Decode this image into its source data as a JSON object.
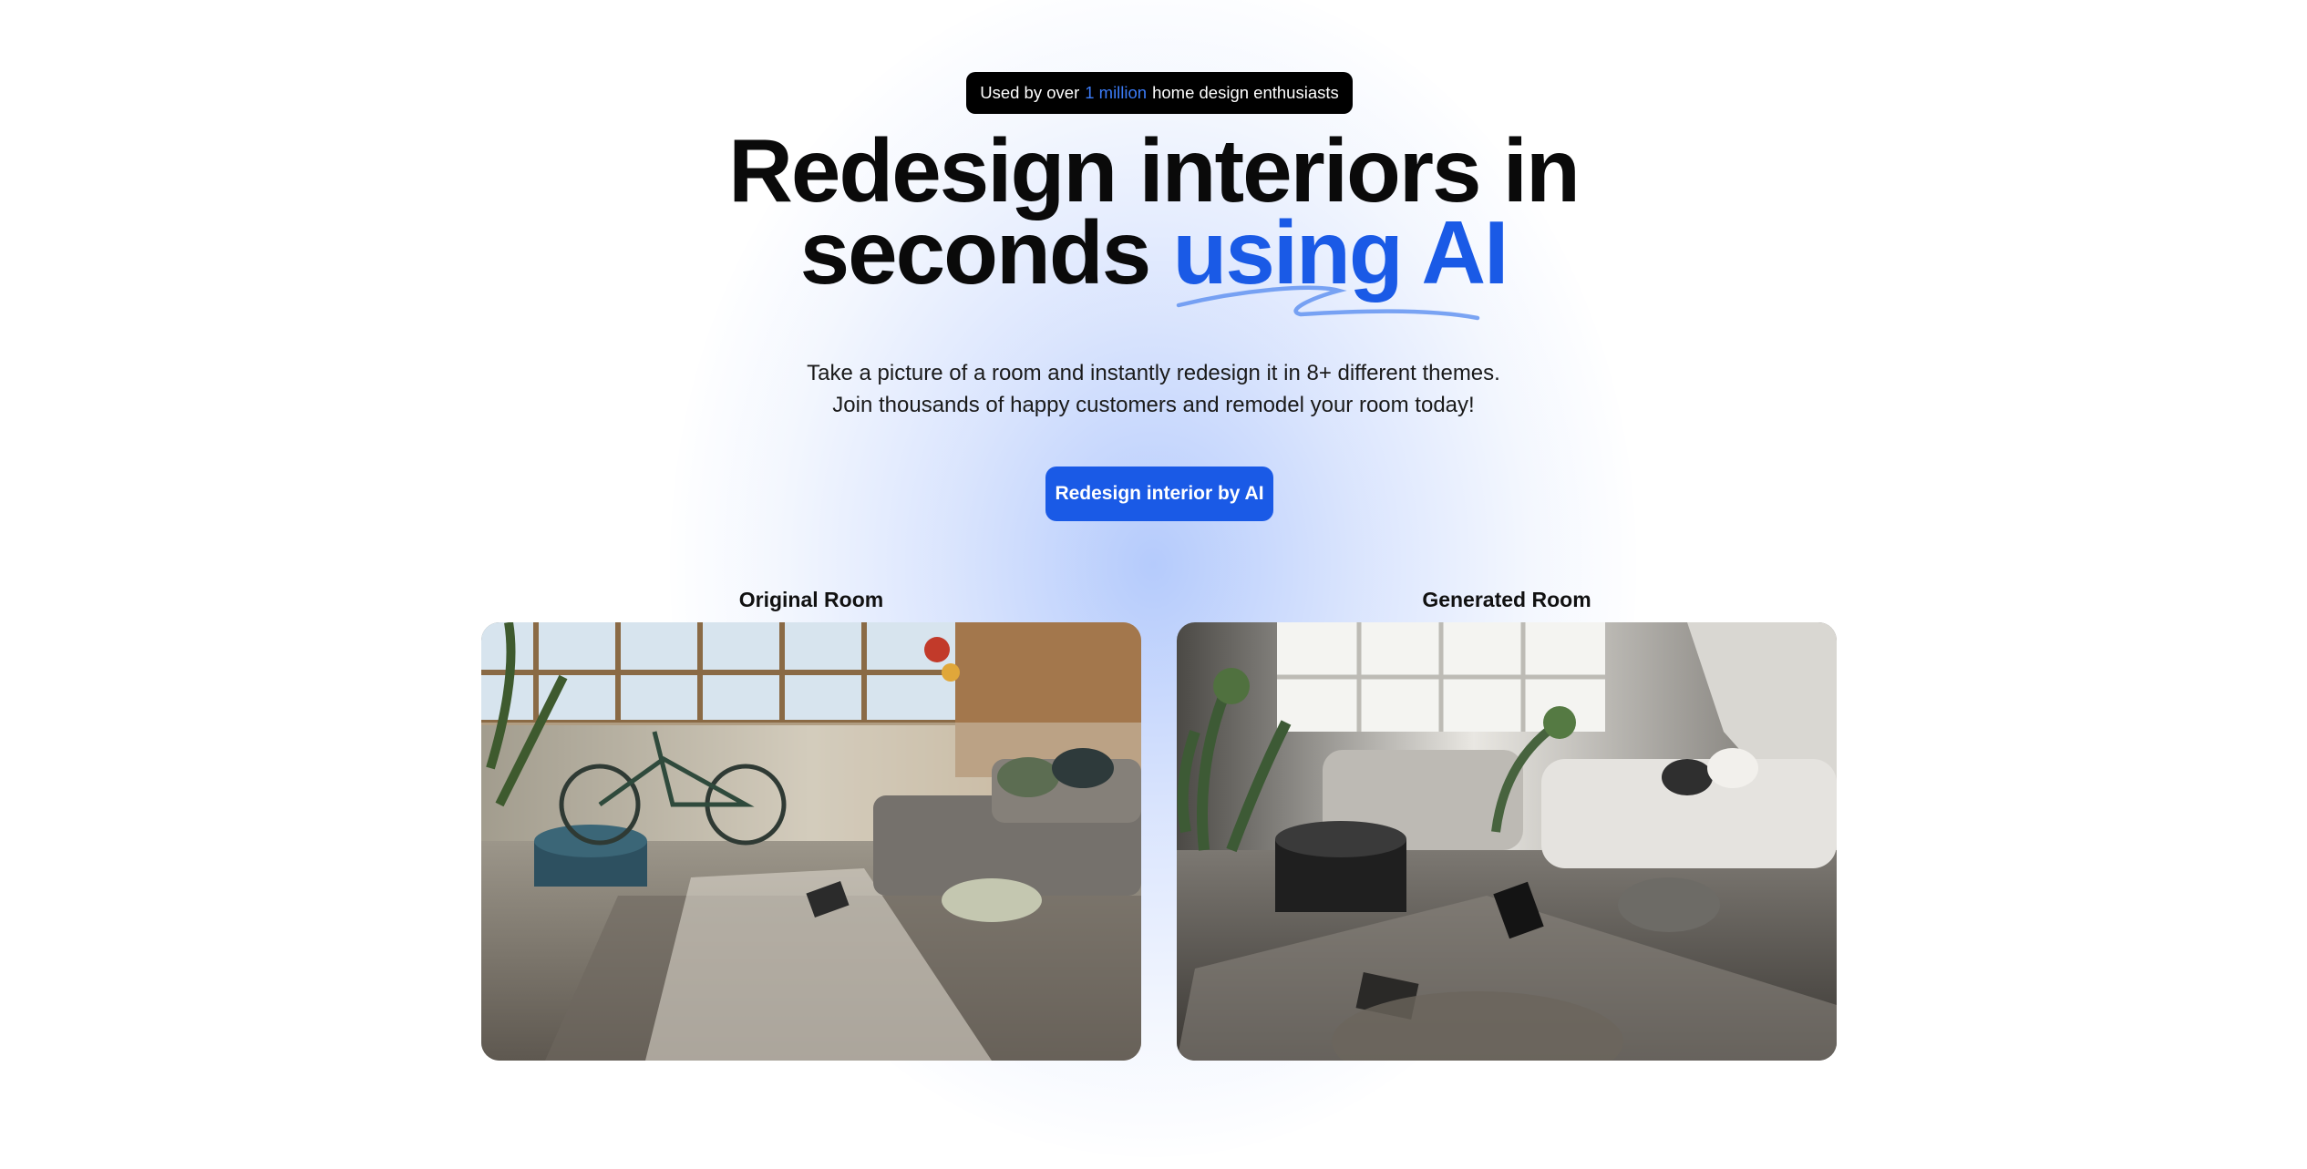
{
  "hero": {
    "badge": {
      "prefix": "Used by over",
      "highlight": "1 million",
      "suffix": "home design enthusiasts"
    },
    "headline": {
      "line1": "Redesign interiors in",
      "line2_plain": "seconds",
      "line2_accent": "using AI"
    },
    "subtitle": {
      "line1": "Take a picture of a room and instantly redesign it in 8+ different themes.",
      "line2": "Join thousands of happy customers and remodel your room today!"
    },
    "cta_label": "Redesign interior by AI"
  },
  "comparison": {
    "original": {
      "caption": "Original Room",
      "image_icon": "living-room-photo"
    },
    "generated": {
      "caption": "Generated Room",
      "image_icon": "generated-room-photo"
    }
  },
  "colors": {
    "accent": "#1a5ae6",
    "badge_highlight": "#3b7bf7",
    "badge_bg": "#000000"
  }
}
